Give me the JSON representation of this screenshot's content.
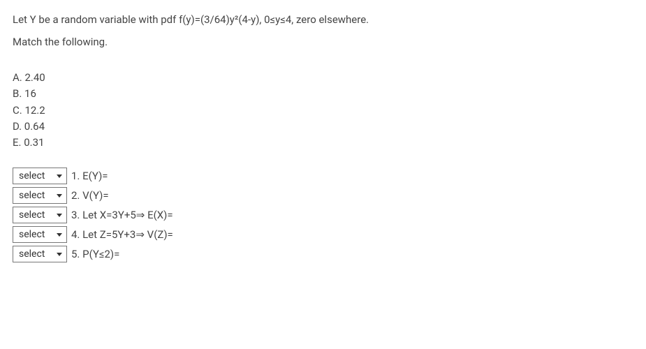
{
  "problem": {
    "line1": "Let Y be a random variable with pdf  f(y)=(3/64)y²(4-y), 0≤y≤4, zero elsewhere.",
    "line2": "Match the following."
  },
  "options": [
    "A. 2.40",
    "B. 16",
    "C. 12.2",
    "D. 0.64",
    "E. 0.31"
  ],
  "select_label": "select",
  "matches": [
    {
      "label": "1. E(Y)="
    },
    {
      "label": "2. V(Y)="
    },
    {
      "label": "3. Let X=3Y+5⇒ E(X)="
    },
    {
      "label": "4. Let Z=5Y+3⇒ V(Z)="
    },
    {
      "label": "5. P(Y≤2)="
    }
  ]
}
